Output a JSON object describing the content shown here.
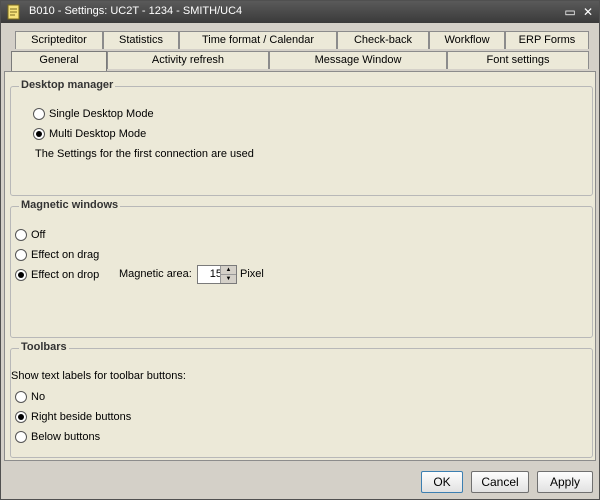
{
  "window": {
    "title": "B010 - Settings: UC2T - 1234 - SMITH/UC4",
    "minimize_glyph": "▭",
    "close_glyph": "✕"
  },
  "tabs_row1": [
    {
      "label": "Scripteditor"
    },
    {
      "label": "Statistics"
    },
    {
      "label": "Time format / Calendar"
    },
    {
      "label": "Check-back"
    },
    {
      "label": "Workflow"
    },
    {
      "label": "ERP Forms"
    }
  ],
  "tabs_row2": [
    {
      "label": "General",
      "active": true
    },
    {
      "label": "Activity refresh"
    },
    {
      "label": "Message Window"
    },
    {
      "label": "Font settings"
    }
  ],
  "desktop_manager": {
    "title": "Desktop manager",
    "options": [
      {
        "label": "Single Desktop Mode",
        "checked": false
      },
      {
        "label": "Multi Desktop Mode",
        "checked": true
      }
    ],
    "note": "The Settings for the first connection are used"
  },
  "magnetic_windows": {
    "title": "Magnetic windows",
    "options": [
      {
        "label": "Off",
        "checked": false
      },
      {
        "label": "Effect on drag",
        "checked": false
      },
      {
        "label": "Effect on drop",
        "checked": true
      }
    ],
    "area_label": "Magnetic area:",
    "area_value": "15",
    "area_unit": "Pixel"
  },
  "toolbars": {
    "title": "Toolbars",
    "prompt": "Show text labels for toolbar buttons:",
    "options": [
      {
        "label": "No",
        "checked": false
      },
      {
        "label": "Right beside buttons",
        "checked": true
      },
      {
        "label": "Below buttons",
        "checked": false
      }
    ]
  },
  "buttons": {
    "ok": "OK",
    "cancel": "Cancel",
    "apply": "Apply"
  },
  "colors": {
    "title_bar": "#4a4a4a",
    "dialog_bg": "#ece9d8"
  }
}
